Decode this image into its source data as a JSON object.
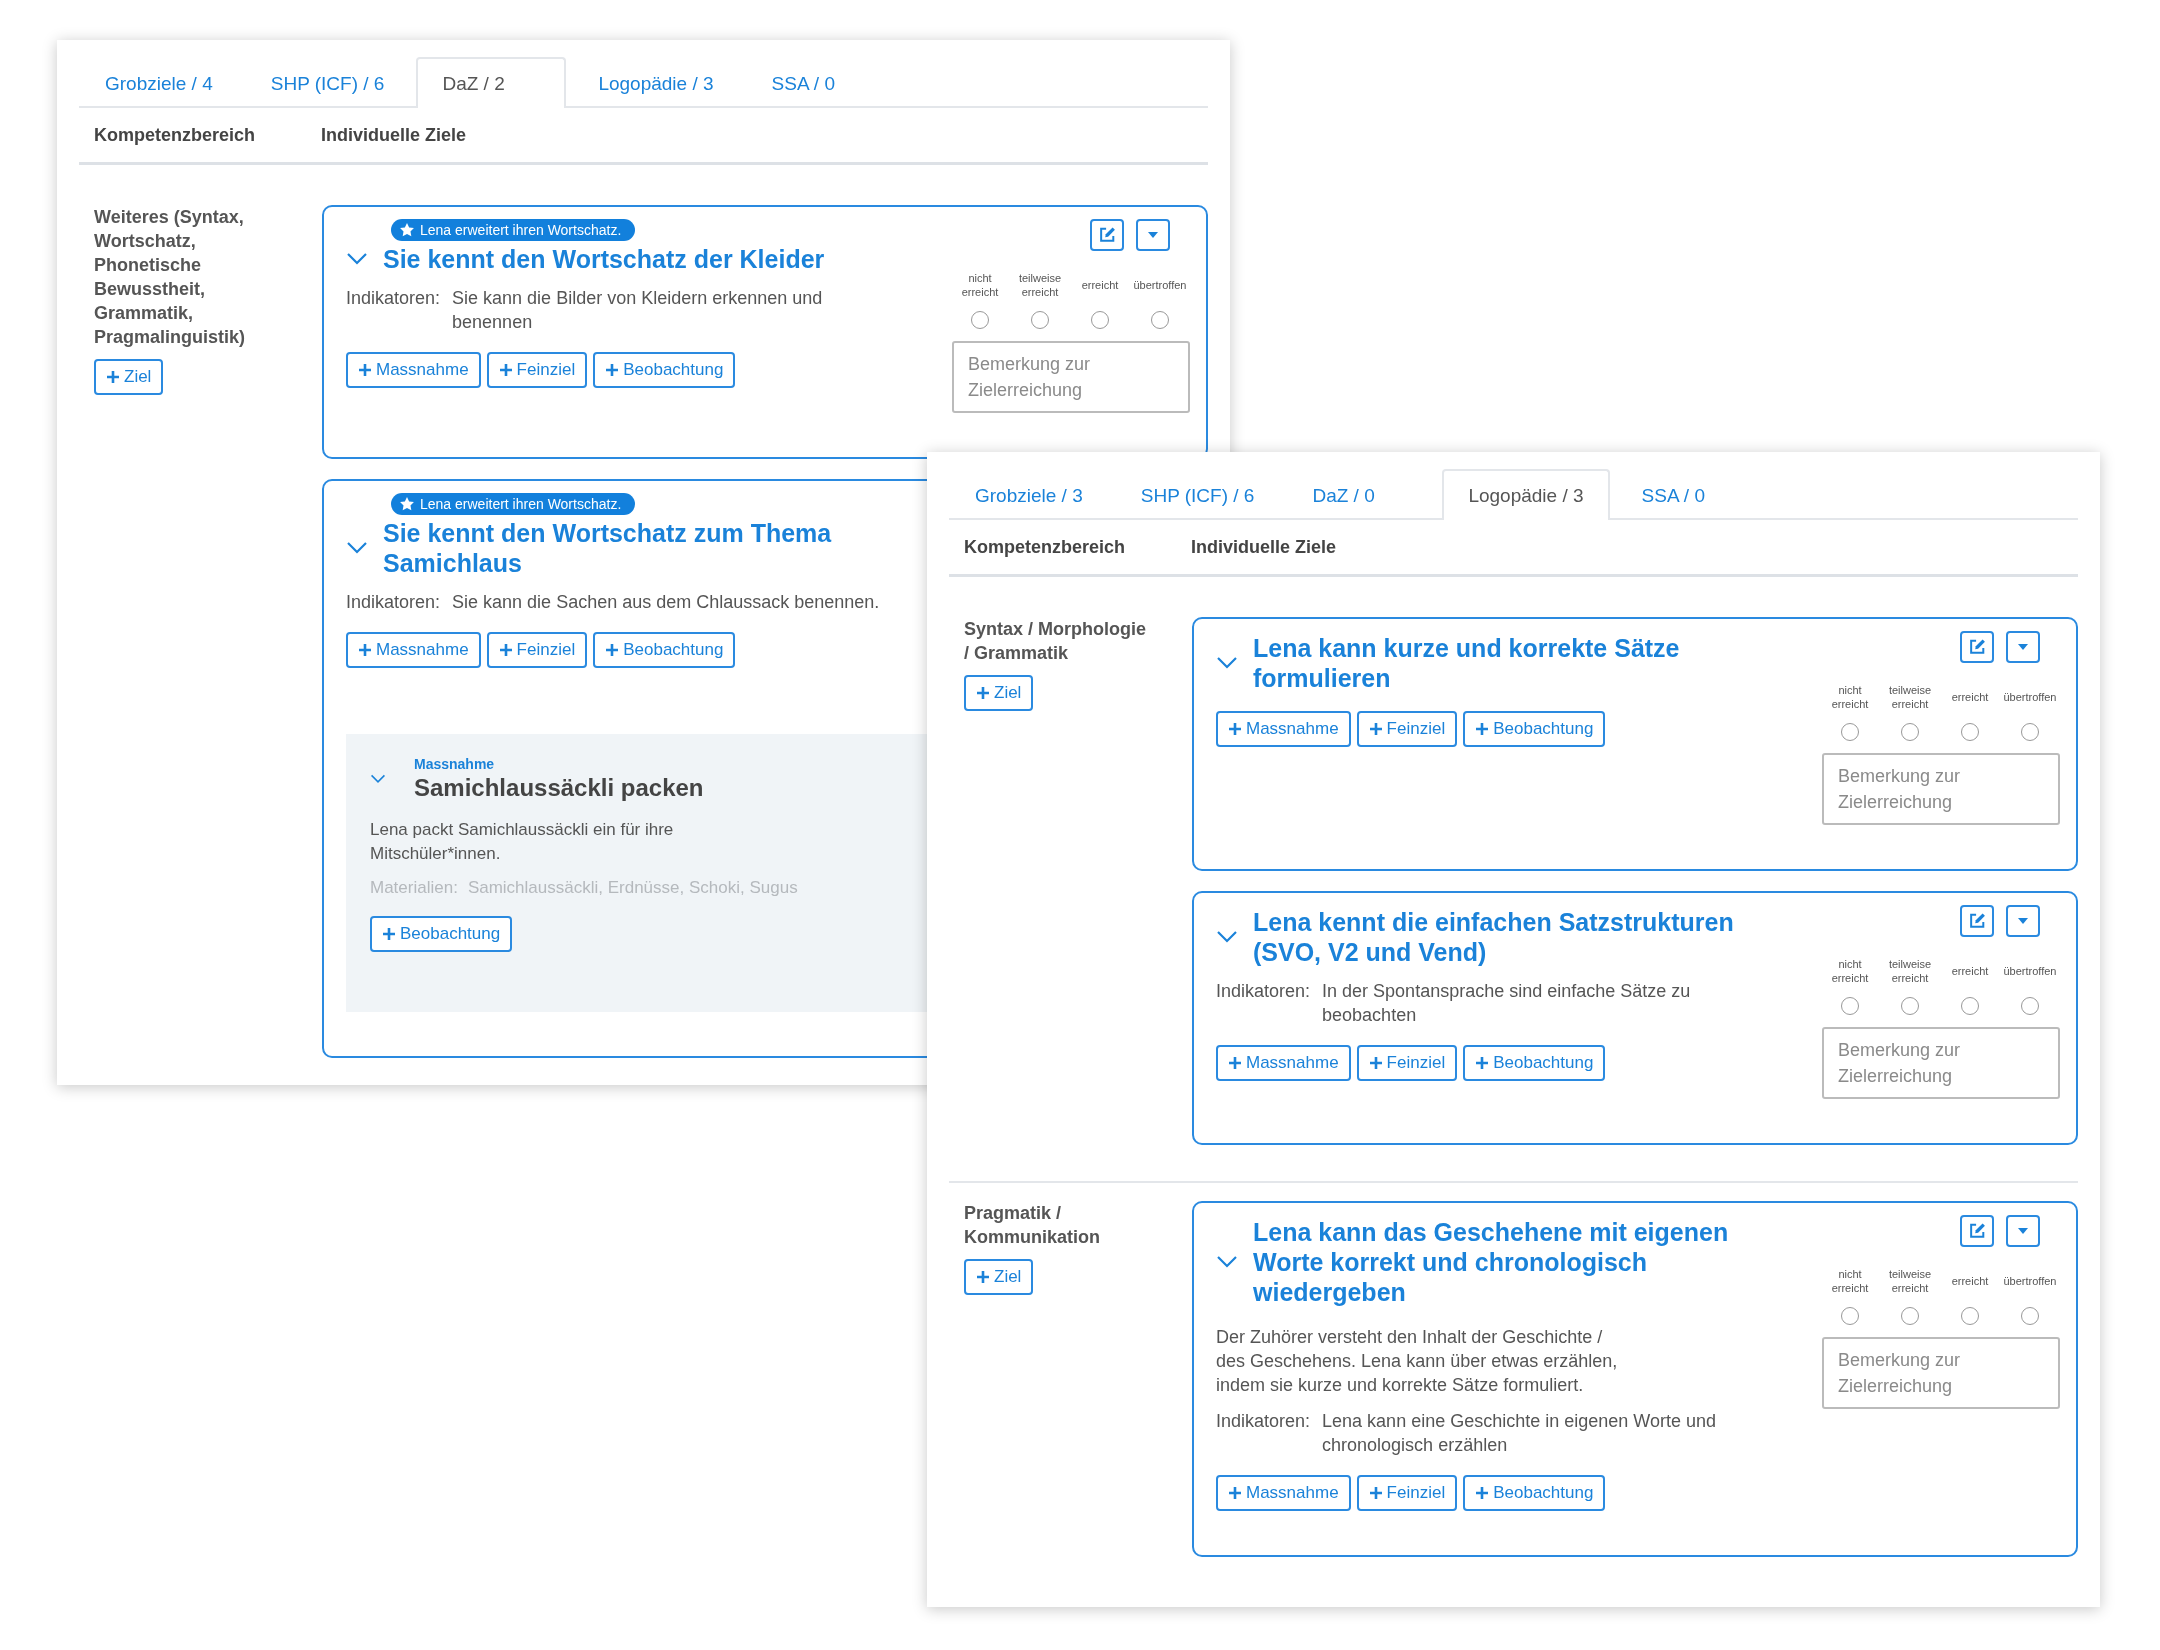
{
  "windows": [
    {
      "tabs": [
        {
          "label": "Grobziele / 4",
          "selected": false
        },
        {
          "label": "SHP (ICF) / 6",
          "selected": false
        },
        {
          "label": "DaZ / 2",
          "selected": true
        },
        {
          "label": "Logopädie / 3",
          "selected": false
        },
        {
          "label": "SSA / 0",
          "selected": false
        }
      ],
      "columns": [
        "Kompetenzbereich",
        "Individuelle Ziele"
      ],
      "sections": [
        {
          "area": "Weiteres (Syntax, Wortschatz, Phonetische Bewusstheit, Grammatik, Pragmalinguistik)",
          "add_label": "Ziel",
          "goals": [
            {
              "badge": "Lena erweitert ihren Wortschatz.",
              "title": "Sie kennt den Wortschatz der Kleider",
              "expanded": true,
              "indicator_label": "Indikatoren:",
              "indicator": "Sie kann die Bilder von Kleidern erkennen und benennen",
              "buttons": [
                "Massnahme",
                "Feinziel",
                "Beobachtung"
              ],
              "tools": true,
              "rating": [
                {
                  "label": "nicht erreicht",
                  "selected": false
                },
                {
                  "label": "teilweise erreicht",
                  "selected": false
                },
                {
                  "label": "erreicht",
                  "selected": false
                },
                {
                  "label": "übertroffen",
                  "selected": false
                }
              ],
              "comment_placeholder": "Bemerkung zur Zielerreichung"
            },
            {
              "badge": "Lena erweitert ihren Wortschatz.",
              "title": "Sie kennt den Wortschatz zum Thema Samichlaus",
              "expanded": true,
              "indicator_label": "Indikatoren:",
              "indicator": "Sie kann die Sachen aus dem Chlaussack benennen.",
              "buttons": [
                "Massnahme",
                "Feinziel",
                "Beobachtung"
              ],
              "tools": false,
              "measures": [
                {
                  "type_label": "Massnahme",
                  "title": "Samichlaussäckli packen",
                  "expanded": true,
                  "description": "Lena packt Samichlaussäckli ein für ihre Mitschüler*innen.",
                  "materials_label": "Materialien:",
                  "materials": "Samichlaussäckli, Erdnüsse, Schoki, Sugus",
                  "buttons": [
                    "Beobachtung"
                  ]
                }
              ]
            }
          ]
        }
      ]
    },
    {
      "tabs": [
        {
          "label": "Grobziele / 3",
          "selected": false
        },
        {
          "label": "SHP (ICF) / 6",
          "selected": false
        },
        {
          "label": "DaZ / 0",
          "selected": false
        },
        {
          "label": "Logopädie / 3",
          "selected": true
        },
        {
          "label": "SSA / 0",
          "selected": false
        }
      ],
      "columns": [
        "Kompetenzbereich",
        "Individuelle Ziele"
      ],
      "sections": [
        {
          "area": "Syntax / Morphologie / Grammatik",
          "add_label": "Ziel",
          "goals": [
            {
              "title": "Lena kann kurze und korrekte Sätze formulieren",
              "expanded": true,
              "buttons": [
                "Massnahme",
                "Feinziel",
                "Beobachtung"
              ],
              "tools": true,
              "rating": [
                {
                  "label": "nicht erreicht",
                  "selected": false
                },
                {
                  "label": "teilweise erreicht",
                  "selected": false
                },
                {
                  "label": "erreicht",
                  "selected": false
                },
                {
                  "label": "übertroffen",
                  "selected": false
                }
              ],
              "comment_placeholder": "Bemerkung zur Zielerreichung"
            },
            {
              "title": "Lena kennt die einfachen Satzstrukturen (SVO, V2 und Vend)",
              "expanded": true,
              "indicator_label": "Indikatoren:",
              "indicator": "In der Spontansprache sind einfache Sätze zu beobachten",
              "buttons": [
                "Massnahme",
                "Feinziel",
                "Beobachtung"
              ],
              "tools": true,
              "rating": [
                {
                  "label": "nicht erreicht",
                  "selected": false
                },
                {
                  "label": "teilweise erreicht",
                  "selected": false
                },
                {
                  "label": "erreicht",
                  "selected": false
                },
                {
                  "label": "übertroffen",
                  "selected": false
                }
              ],
              "comment_placeholder": "Bemerkung zur Zielerreichung"
            }
          ]
        },
        {
          "area": "Pragmatik / Kommunikation",
          "add_label": "Ziel",
          "goals": [
            {
              "title": "Lena kann das Geschehene mit eigenen Worte korrekt und chronologisch wiedergeben",
              "expanded": true,
              "description": "Der Zuhörer versteht den Inhalt der Geschichte / des Geschehens. Lena kann über etwas erzählen, indem sie kurze und korrekte Sätze formuliert.",
              "indicator_label": "Indikatoren:",
              "indicator": "Lena kann eine Geschichte in eigenen Worte und chronologisch erzählen",
              "buttons": [
                "Massnahme",
                "Feinziel",
                "Beobachtung"
              ],
              "tools": true,
              "rating": [
                {
                  "label": "nicht erreicht",
                  "selected": false
                },
                {
                  "label": "teilweise erreicht",
                  "selected": false
                },
                {
                  "label": "erreicht",
                  "selected": false
                },
                {
                  "label": "übertroffen",
                  "selected": false
                }
              ],
              "comment_placeholder": "Bemerkung zur Zielerreichung"
            }
          ]
        }
      ]
    }
  ]
}
